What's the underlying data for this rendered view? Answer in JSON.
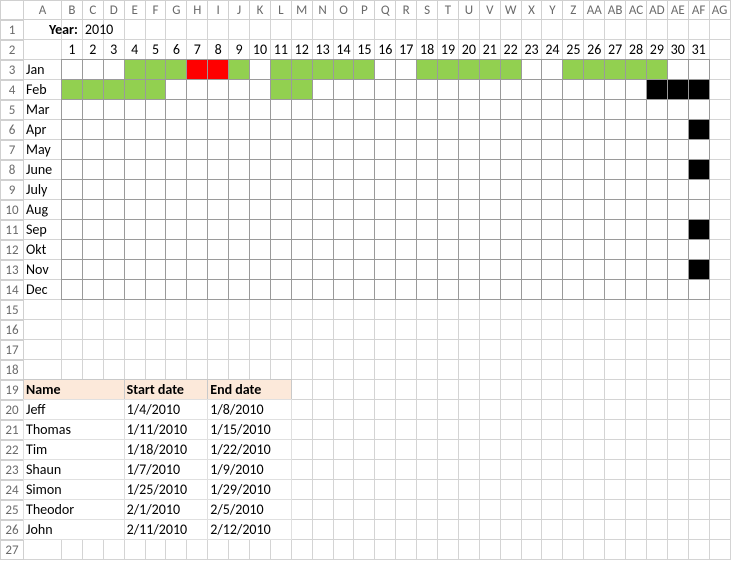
{
  "year_label": "Year:",
  "year_value": "2010",
  "columns_data": [
    "A",
    "B",
    "C",
    "D",
    "E",
    "F",
    "G",
    "H",
    "I",
    "J",
    "K",
    "L",
    "M",
    "N",
    "O",
    "P",
    "Q",
    "R",
    "S",
    "T",
    "U",
    "V",
    "W",
    "X",
    "Y",
    "Z",
    "AA",
    "AB",
    "AC",
    "AD",
    "AE",
    "AF",
    "AG"
  ],
  "day_numbers": [
    "1",
    "2",
    "3",
    "4",
    "5",
    "6",
    "7",
    "8",
    "9",
    "10",
    "11",
    "12",
    "13",
    "14",
    "15",
    "16",
    "17",
    "18",
    "19",
    "20",
    "21",
    "22",
    "23",
    "24",
    "25",
    "26",
    "27",
    "28",
    "29",
    "30",
    "31"
  ],
  "months": [
    "Jan",
    "Feb",
    "Mar",
    "Apr",
    "May",
    "June",
    "July",
    "Aug",
    "Sep",
    "Okt",
    "Nov",
    "Dec"
  ],
  "row_numbers": [
    "1",
    "2",
    "3",
    "4",
    "5",
    "6",
    "7",
    "8",
    "9",
    "10",
    "11",
    "12",
    "13",
    "14",
    "15",
    "16",
    "17",
    "18",
    "19",
    "20",
    "21",
    "22",
    "23",
    "24",
    "25",
    "26",
    "27"
  ],
  "calendar": {
    "Jan": [
      {
        "day": 4,
        "c": "green"
      },
      {
        "day": 5,
        "c": "green"
      },
      {
        "day": 6,
        "c": "green"
      },
      {
        "day": 7,
        "c": "red"
      },
      {
        "day": 8,
        "c": "red"
      },
      {
        "day": 9,
        "c": "green"
      },
      {
        "day": 11,
        "c": "green"
      },
      {
        "day": 12,
        "c": "green"
      },
      {
        "day": 13,
        "c": "green"
      },
      {
        "day": 14,
        "c": "green"
      },
      {
        "day": 15,
        "c": "green"
      },
      {
        "day": 18,
        "c": "green"
      },
      {
        "day": 19,
        "c": "green"
      },
      {
        "day": 20,
        "c": "green"
      },
      {
        "day": 21,
        "c": "green"
      },
      {
        "day": 22,
        "c": "green"
      },
      {
        "day": 25,
        "c": "green"
      },
      {
        "day": 26,
        "c": "green"
      },
      {
        "day": 27,
        "c": "green"
      },
      {
        "day": 28,
        "c": "green"
      },
      {
        "day": 29,
        "c": "green"
      }
    ],
    "Feb": [
      {
        "day": 1,
        "c": "green"
      },
      {
        "day": 2,
        "c": "green"
      },
      {
        "day": 3,
        "c": "green"
      },
      {
        "day": 4,
        "c": "green"
      },
      {
        "day": 5,
        "c": "green"
      },
      {
        "day": 11,
        "c": "green"
      },
      {
        "day": 12,
        "c": "green"
      },
      {
        "day": 29,
        "c": "black"
      },
      {
        "day": 30,
        "c": "black"
      },
      {
        "day": 31,
        "c": "black"
      }
    ],
    "Apr": [
      {
        "day": 31,
        "c": "black"
      }
    ],
    "June": [
      {
        "day": 31,
        "c": "black"
      }
    ],
    "Sep": [
      {
        "day": 31,
        "c": "black"
      }
    ],
    "Nov": [
      {
        "day": 31,
        "c": "black"
      }
    ]
  },
  "table": {
    "headers": {
      "name": "Name",
      "start": "Start date",
      "end": "End date"
    },
    "rows": [
      {
        "name": "Jeff",
        "start": "1/4/2010",
        "end": "1/8/2010"
      },
      {
        "name": "Thomas",
        "start": "1/11/2010",
        "end": "1/15/2010"
      },
      {
        "name": "Tim",
        "start": "1/18/2010",
        "end": "1/22/2010"
      },
      {
        "name": "Shaun",
        "start": "1/7/2010",
        "end": "1/9/2010"
      },
      {
        "name": "Simon",
        "start": "1/25/2010",
        "end": "1/29/2010"
      },
      {
        "name": "Theodor",
        "start": "2/1/2010",
        "end": "2/5/2010"
      },
      {
        "name": "John",
        "start": "2/11/2010",
        "end": "2/12/2010"
      }
    ]
  }
}
